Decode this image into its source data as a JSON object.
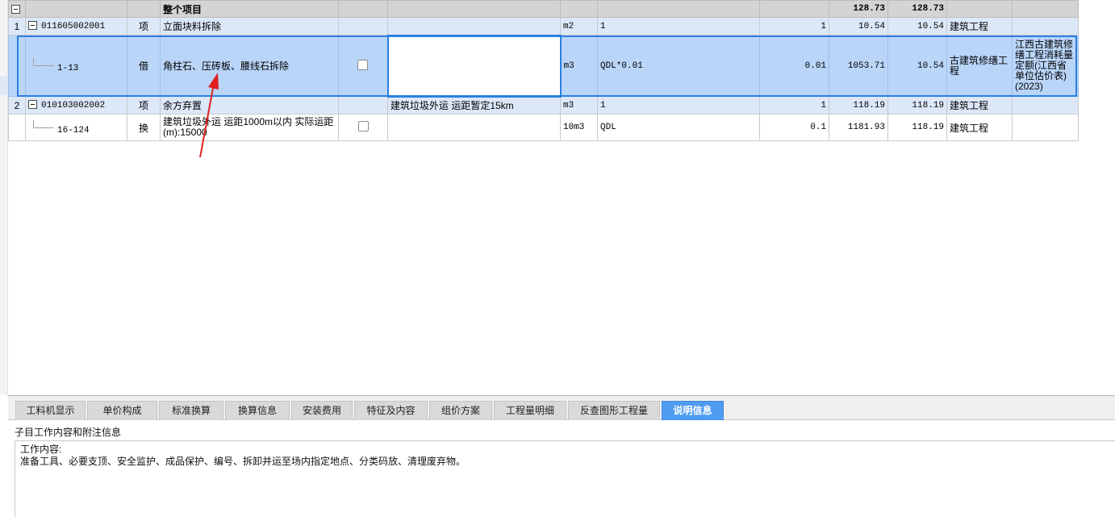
{
  "grid": {
    "top_row": {
      "name": "整个项目",
      "total1": "128.73",
      "total2": "128.73"
    },
    "rows": [
      {
        "idx": "1",
        "code": "011605002001",
        "type": "项",
        "name": "立面块料拆除",
        "feature": "",
        "unit": "m2",
        "expr": "1",
        "qty": "1",
        "price": "10.54",
        "total": "10.54",
        "major": "建筑工程",
        "book": ""
      },
      {
        "idx": "",
        "code": "1-13",
        "type": "借",
        "name": "角柱石、压砖板、腰线石拆除",
        "feature": "",
        "unit": "m3",
        "expr": "QDL*0.01",
        "qty": "0.01",
        "price": "1053.71",
        "total": "10.54",
        "major": "古建筑修缮工程",
        "book": "江西古建筑修缮工程消耗量定额(江西省单位估价表)(2023)"
      },
      {
        "idx": "2",
        "code": "010103002002",
        "type": "项",
        "name": "余方弃置",
        "feature": "建筑垃圾外运 运距暂定15km",
        "unit": "m3",
        "expr": "1",
        "qty": "1",
        "price": "118.19",
        "total": "118.19",
        "major": "建筑工程",
        "book": ""
      },
      {
        "idx": "",
        "code": "16-124",
        "type": "换",
        "name": "建筑垃圾外运 运距1000m以内  实际运距(m):15000",
        "feature": "",
        "unit": "10m3",
        "expr": "QDL",
        "qty": "0.1",
        "price": "1181.93",
        "total": "118.19",
        "major": "建筑工程",
        "book": ""
      }
    ]
  },
  "tabs": [
    {
      "label": "工料机显示"
    },
    {
      "label": "单价构成"
    },
    {
      "label": "标准换算"
    },
    {
      "label": "换算信息"
    },
    {
      "label": "安装费用"
    },
    {
      "label": "特征及内容"
    },
    {
      "label": "组价方案"
    },
    {
      "label": "工程量明细"
    },
    {
      "label": "反查图形工程量"
    },
    {
      "label": "说明信息"
    }
  ],
  "active_tab": "说明信息",
  "panel": {
    "subtitle": "子目工作内容和附注信息",
    "content_label": "工作内容:",
    "content_text": "准备工具、必要支顶、安全监护、成品保护、编号、拆卸并运至场内指定地点、分类码放、清理废弃物。"
  },
  "colors": {
    "selection": "#2a7fe0",
    "active_tab": "#4f9cf2",
    "arrow": "#e02020"
  }
}
